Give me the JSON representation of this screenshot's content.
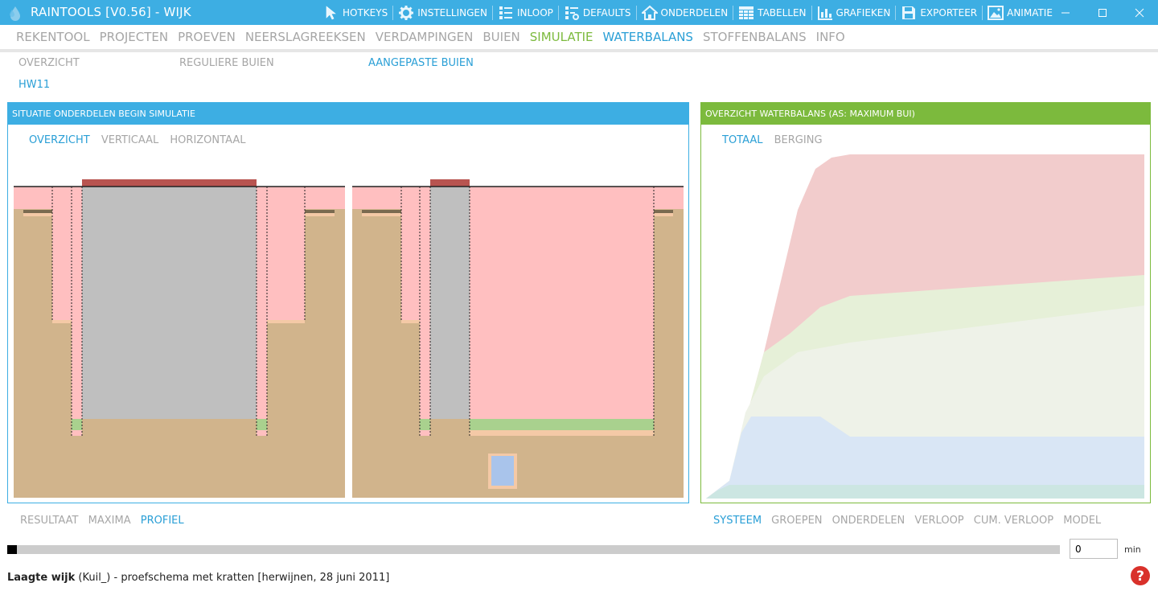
{
  "window": {
    "title": "RAINTOOLS [V0.56] - WIJK"
  },
  "toolbar": [
    {
      "label": "HOTKEYS",
      "icon": "cursor-icon"
    },
    {
      "label": "INSTELLINGEN",
      "icon": "gear-icon"
    },
    {
      "label": "INLOOP",
      "icon": "list-icon"
    },
    {
      "label": "DEFAULTS",
      "icon": "list-gear-icon"
    },
    {
      "label": "ONDERDELEN",
      "icon": "house-icon"
    },
    {
      "label": "TABELLEN",
      "icon": "table-icon"
    },
    {
      "label": "GRAFIEKEN",
      "icon": "bar-chart-icon"
    },
    {
      "label": "EXPORTEER",
      "icon": "floppy-icon"
    },
    {
      "label": "ANIMATIE",
      "icon": "image-icon"
    }
  ],
  "main_nav": [
    {
      "label": "REKENTOOL",
      "state": "normal"
    },
    {
      "label": "PROJECTEN",
      "state": "normal"
    },
    {
      "label": "PROEVEN",
      "state": "normal"
    },
    {
      "label": "NEERSLAGREEKSEN",
      "state": "normal"
    },
    {
      "label": "VERDAMPINGEN",
      "state": "normal"
    },
    {
      "label": "BUIEN",
      "state": "normal"
    },
    {
      "label": "SIMULATIE",
      "state": "green"
    },
    {
      "label": "WATERBALANS",
      "state": "blue"
    },
    {
      "label": "STOFFENBALANS",
      "state": "normal"
    },
    {
      "label": "INFO",
      "state": "normal"
    }
  ],
  "sub_nav": {
    "overzicht": "OVERZICHT",
    "reguliere": "REGULIERE BUIEN",
    "aangepaste": "AANGEPASTE BUIEN",
    "scenario": "HW11"
  },
  "left_panel": {
    "title": "SITUATIE ONDERDELEN BEGIN SIMULATIE",
    "tabs": [
      "OVERZICHT",
      "VERTICAAL",
      "HORIZONTAAL"
    ]
  },
  "right_panel": {
    "title": "OVERZICHT WATERBALANS  (AS: MAXIMUM BUI)",
    "tabs": [
      "TOTAAL",
      "BERGING"
    ]
  },
  "bottom_left_tabs": [
    "RESULTAAT",
    "MAXIMA",
    "PROFIEL"
  ],
  "bottom_right_tabs": [
    "SYSTEEM",
    "GROEPEN",
    "ONDERDELEN",
    "VERLOOP",
    "CUM. VERLOOP",
    "MODEL"
  ],
  "time": {
    "value": "0",
    "unit": "min",
    "progress": 0
  },
  "status": {
    "bold": "Laagte wijk",
    "rest": " (Kuil_) - proefschema met kratten [herwijnen, 28 juni 2011]"
  },
  "colors": {
    "accent_blue": "#3daee3",
    "accent_green": "#7cba3d",
    "soil": "#d1b48c",
    "water": "#ffbfc0",
    "concrete": "#bfbfbf",
    "roof": "#b85450"
  }
}
